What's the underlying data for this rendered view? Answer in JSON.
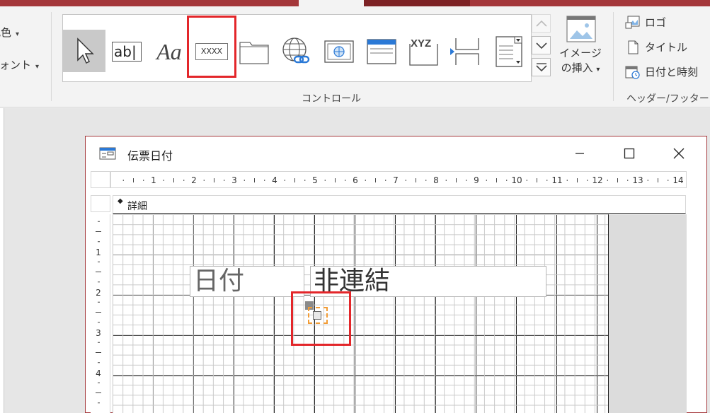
{
  "ribbon": {
    "left_items": [
      "配色",
      "フォント"
    ],
    "controls_label": "コントロール",
    "image_insert": {
      "line1": "イメージ",
      "line2": "の挿入"
    },
    "header_footer": {
      "logo": "ロゴ",
      "title": "タイトル",
      "date_time": "日付と時刻",
      "group_label": "ヘッダー/フッター"
    },
    "tools": [
      {
        "name": "select",
        "label": "選択"
      },
      {
        "name": "textbox",
        "label": "ab|"
      },
      {
        "name": "label",
        "label": "Aa"
      },
      {
        "name": "button",
        "label": "XXXX"
      },
      {
        "name": "tab",
        "label": ""
      },
      {
        "name": "hyperlink",
        "label": ""
      },
      {
        "name": "web-browser",
        "label": ""
      },
      {
        "name": "navigation",
        "label": ""
      },
      {
        "name": "option-group",
        "label": "XYZ"
      },
      {
        "name": "page-break",
        "label": ""
      },
      {
        "name": "combo",
        "label": ""
      }
    ]
  },
  "form": {
    "title": "伝票日付",
    "section": "詳細",
    "ruler_numbers": [
      "1",
      "2",
      "3",
      "4",
      "5",
      "6",
      "7",
      "8",
      "9",
      "10",
      "11",
      "12",
      "13",
      "14"
    ],
    "vruler_numbers": [
      "1",
      "2",
      "3",
      "4"
    ],
    "label_text": "日付",
    "textbox_text": "非連結"
  }
}
